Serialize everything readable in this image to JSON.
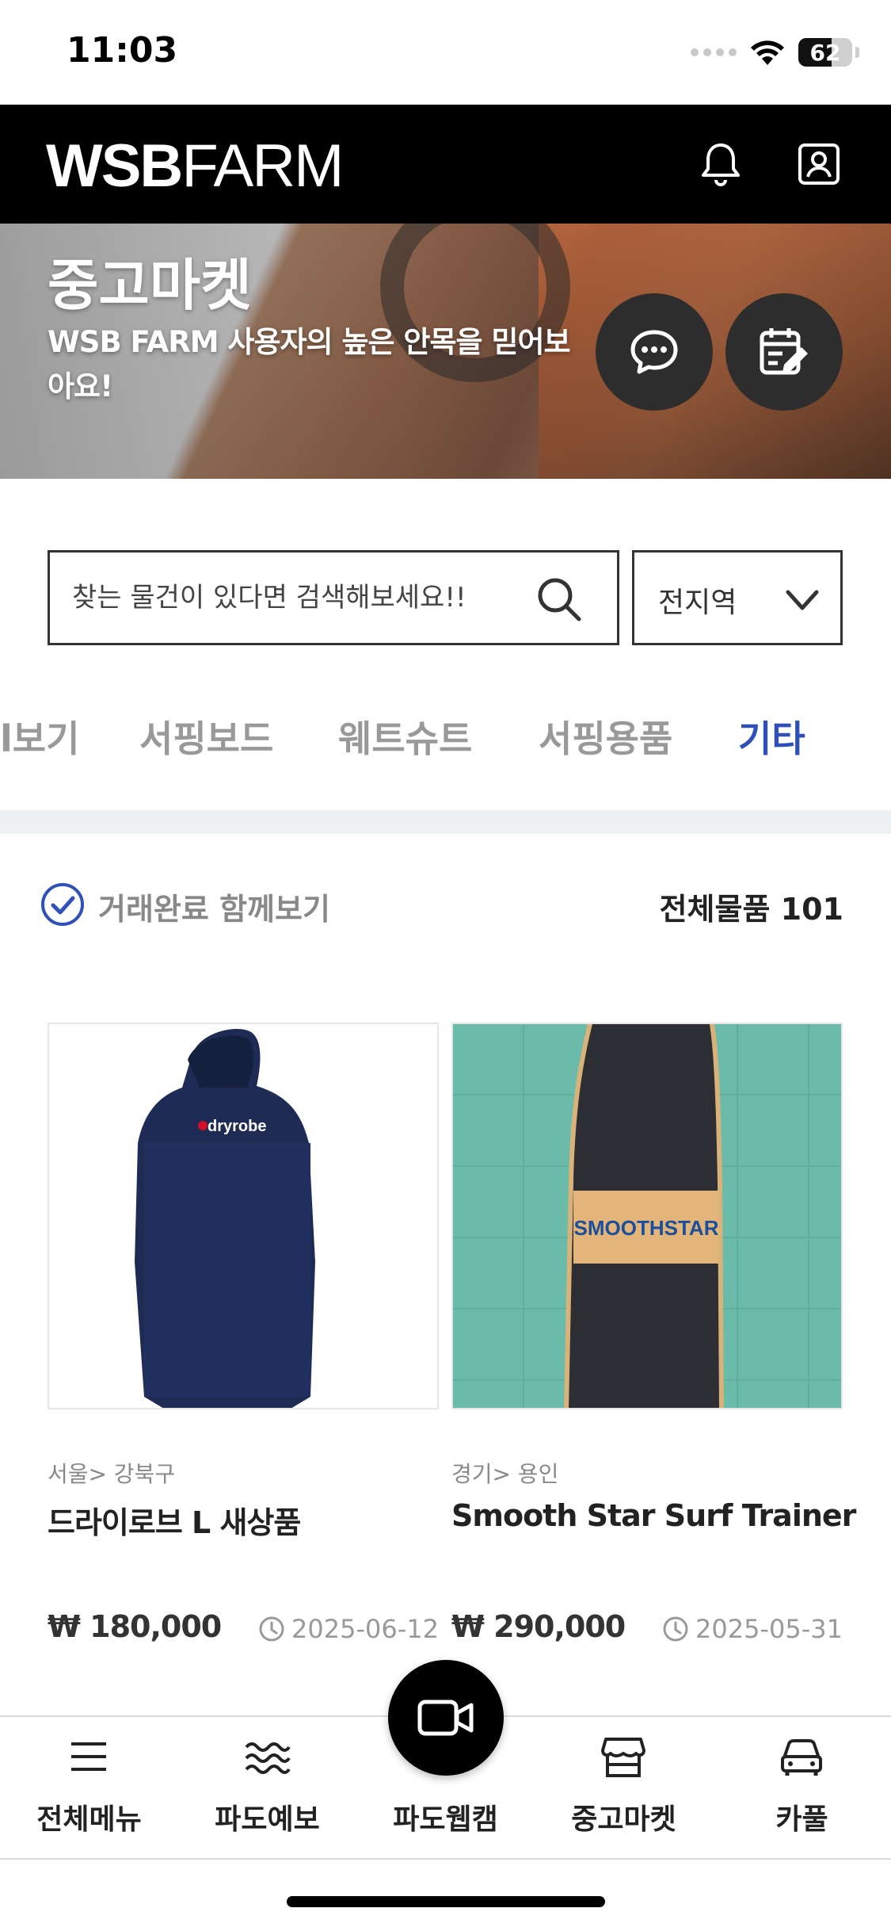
{
  "status_bar": {
    "time": "11:03",
    "battery": "62",
    "battery_level": 0.62
  },
  "header": {
    "logo_bold": "WSB",
    "logo_thin": "FARM",
    "notification_icon": "bell-icon",
    "profile_icon": "user-icon"
  },
  "hero": {
    "title": "중고마켓",
    "subtitle": "WSB FARM 사용자의 높은 안목을 믿어보아요!",
    "chat_icon": "chat-bubble-icon",
    "write_icon": "edit-calendar-icon"
  },
  "search": {
    "placeholder": "찾는 물건이 있다면 검색해보세요!!",
    "region": "전지역"
  },
  "tabs": [
    {
      "label": "l보기",
      "active": false
    },
    {
      "label": "서핑보드",
      "active": false
    },
    {
      "label": "웨트슈트",
      "active": false
    },
    {
      "label": "서핑용품",
      "active": false
    },
    {
      "label": "기타",
      "active": true
    }
  ],
  "filter": {
    "label": "거래완료 함께보기",
    "total": "전체물품 101"
  },
  "products": [
    {
      "region": "서울> 강북구",
      "title": "드라이로브 L 새상품",
      "price": "₩ 180,000",
      "date": "2025-06-12",
      "image_logo": "dryrobe"
    },
    {
      "region": "경기> 용인",
      "title": "Smooth Star Surf Trainer",
      "price": "₩ 290,000",
      "date": "2025-05-31",
      "image_logo": "SMOOTHSTAR"
    }
  ],
  "bottom_nav": [
    {
      "label": "전체메뉴",
      "icon": "menu-icon"
    },
    {
      "label": "파도예보",
      "icon": "wave-icon"
    },
    {
      "label": "파도웹캠",
      "icon": "video-camera-icon"
    },
    {
      "label": "중고마켓",
      "icon": "store-icon"
    },
    {
      "label": "카풀",
      "icon": "car-icon"
    }
  ],
  "colors": {
    "accent": "#2f50b8",
    "header_bg": "#000000"
  }
}
